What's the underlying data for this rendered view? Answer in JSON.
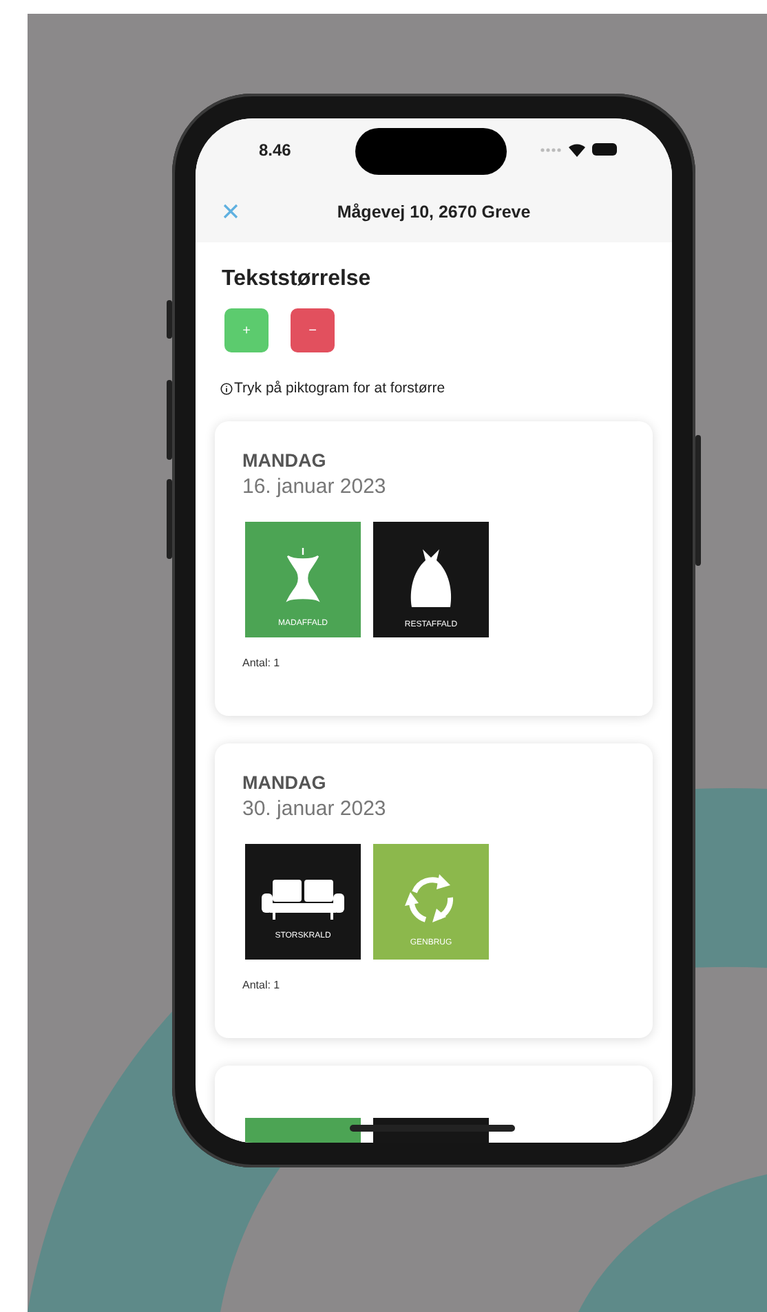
{
  "status_bar": {
    "time": "8.46"
  },
  "nav": {
    "title": "Mågevej 10, 2670 Greve"
  },
  "text_size": {
    "title": "Tekststørrelse",
    "buttons": [
      {
        "kind": "increase",
        "label": "+"
      },
      {
        "kind": "decrease",
        "label": "−"
      }
    ]
  },
  "hint": "Tryk på piktogram for at forstørre",
  "cards": [
    {
      "day": "MANDAG",
      "date": "16. januar 2023",
      "pictograms": [
        {
          "kind": "food",
          "label": "MADAFFALD",
          "color": "#4ca454"
        },
        {
          "kind": "residual",
          "label": "RESTAFFALD",
          "color": "#161616"
        }
      ],
      "count": "Antal: 1"
    },
    {
      "day": "MANDAG",
      "date": "30. januar 2023",
      "pictograms": [
        {
          "kind": "bulky",
          "label": "STORSKRALD",
          "color": "#161616"
        },
        {
          "kind": "recycling",
          "label": "GENBRUG",
          "color": "#8cb84c"
        }
      ],
      "count": "Antal: 1"
    },
    {
      "pictograms": [
        {
          "kind": "food",
          "color": "#4ca454"
        },
        {
          "kind": "residual",
          "color": "#161616"
        }
      ]
    }
  ]
}
